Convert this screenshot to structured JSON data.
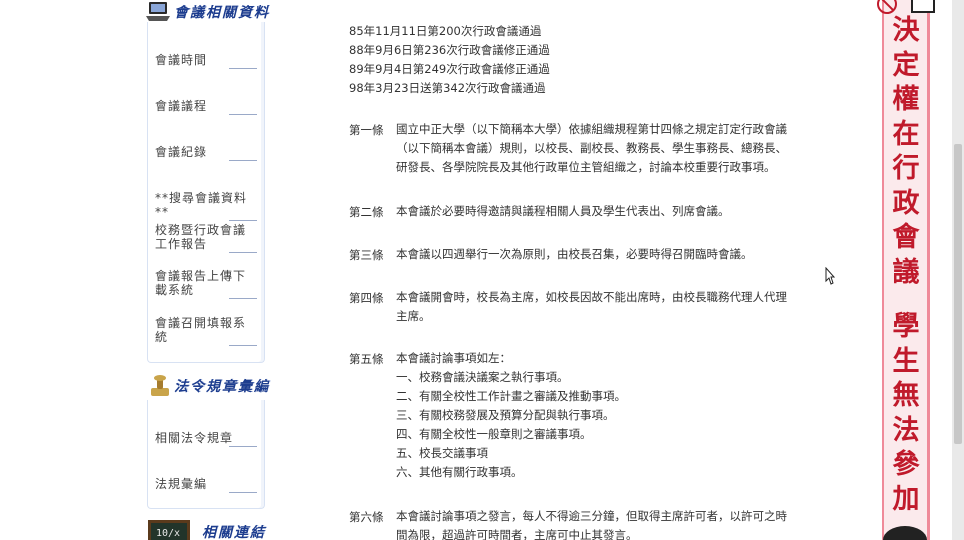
{
  "sidebar": {
    "meeting_header": "會議相關資料",
    "meeting_links": [
      "會議時間",
      "會議議程",
      "會議紀錄",
      "**搜尋會議資料**",
      "校務暨行政會議工作報告",
      "會議報告上傳下載系統",
      "會議召開填報系統"
    ],
    "law_header": "法令規章彙編",
    "law_links": [
      "相關法令規章",
      "法規彙編"
    ],
    "links_header": "相關連結"
  },
  "history": [
    "85年11月11日第200次行政會議通過",
    "88年9月6日第236次行政會議修正通過",
    "89年9月4日第249次行政會議修正通過",
    "98年3月23日送第342次行政會議通過"
  ],
  "articles": [
    {
      "no": "第一條",
      "lines": [
        "國立中正大學（以下簡稱本大學）依據組織規程第廿四條之規定訂定行政會議",
        "（以下簡稱本會議）規則，以校長、副校長、教務長、學生事務長、總務長、",
        "研發長、各學院院長及其他行政單位主管組織之，討論本校重要行政事項。"
      ]
    },
    {
      "no": "第二條",
      "lines": [
        "本會議於必要時得邀請與議程相關人員及學生代表出、列席會議。"
      ]
    },
    {
      "no": "第三條",
      "lines": [
        "本會議以四週舉行一次為原則，由校長召集，必要時得召開臨時會議。"
      ]
    },
    {
      "no": "第四條",
      "lines": [
        "本會議開會時，校長為主席，如校長因故不能出席時，由校長職務代理人代理",
        "主席。"
      ]
    },
    {
      "no": "第五條",
      "lines": [
        "本會議討論事項如左：",
        "一、校務會議決議案之執行事項。",
        "二、有關全校性工作計畫之審議及推動事項。",
        "三、有關校務發展及預算分配與執行事項。",
        "四、有關全校性一般章則之審議事項。",
        "五、校長交議事項",
        "六、其他有關行政事項。"
      ]
    },
    {
      "no": "第六條",
      "lines": [
        "本會議討論事項之發言，每人不得逾三分鐘，但取得主席許可者，以許可之時",
        "間為限，超過許可時間者，主席可中止其發言。"
      ]
    }
  ],
  "banner": {
    "text": "決定權在行政會議 學生無法參加",
    "chars": [
      "決",
      "定",
      "權",
      "在",
      "行",
      "政",
      "會",
      "議",
      "",
      "學",
      "生",
      "無",
      "法",
      "參",
      "加"
    ]
  },
  "colors": {
    "header_blue": "#1d3d8f",
    "banner_red": "#c01a2b",
    "banner_bg": "#fbeaec",
    "banner_edge": "#ef8a99"
  }
}
